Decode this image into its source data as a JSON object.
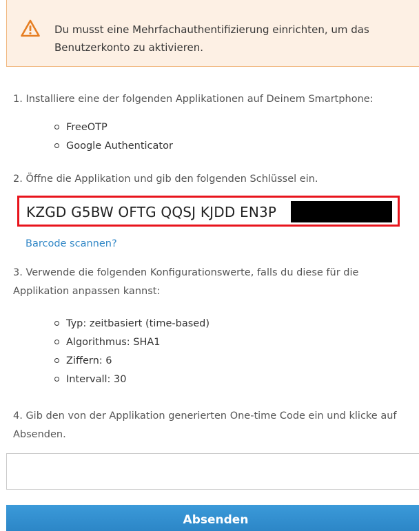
{
  "alert": {
    "icon": "warning-icon",
    "icon_color": "#e67e22",
    "text": "Du musst eine Mehrfachauthentifizierung einrichten, um das Benutzerkonto zu aktivieren."
  },
  "steps": {
    "step1": "1. Installiere eine der folgenden Applikationen auf Deinem Smartphone:",
    "apps": [
      "FreeOTP",
      "Google Authenticator"
    ],
    "step2": "2. Öffne die Applikation und gib den folgenden Schlüssel ein.",
    "secret_key_visible": "KZGD G5BW OFTG QQSJ KJDD EN3P",
    "barcode_link": "Barcode scannen?",
    "step3": "3. Verwende die folgenden Konfigurationswerte, falls du diese für die Applikation anpassen kannst:",
    "config": [
      "Typ: zeitbasiert (time-based)",
      "Algorithmus: SHA1",
      "Ziffern: 6",
      "Intervall: 30"
    ],
    "step4": "4. Gib den von der Applikation generierten One-time Code ein und klicke auf Absenden."
  },
  "form": {
    "otp_value": "",
    "submit_label": "Absenden"
  },
  "colors": {
    "alert_bg": "#fdf0e4",
    "alert_border": "#f1b982",
    "highlight_border": "#e8141c",
    "link": "#2f86c6",
    "button": "#2a83c4"
  }
}
